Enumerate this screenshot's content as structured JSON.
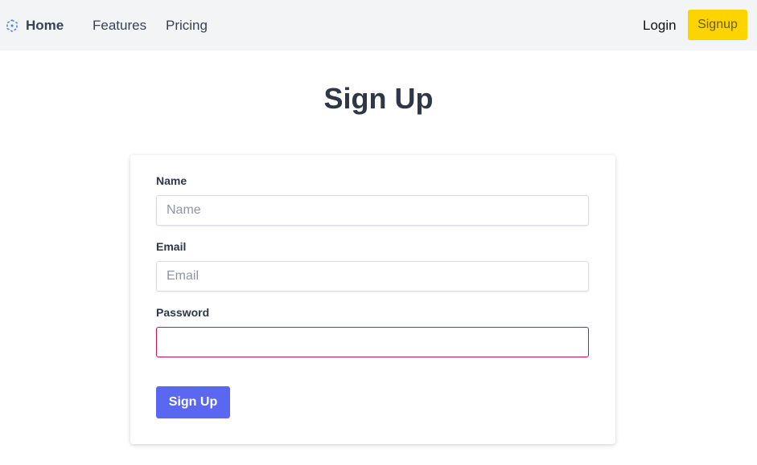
{
  "navbar": {
    "brand_label": "Home",
    "brand_icon": "cube-logo-icon",
    "links": [
      "Features",
      "Pricing"
    ],
    "login_label": "Login",
    "signup_label": "Signup"
  },
  "page": {
    "title": "Sign Up"
  },
  "form": {
    "name_label": "Name",
    "name_placeholder": "Name",
    "name_value": "",
    "email_label": "Email",
    "email_placeholder": "Email",
    "email_value": "",
    "password_label": "Password",
    "password_value": "",
    "submit_label": "Sign Up"
  },
  "colors": {
    "navbar_bg": "#f3f4f6",
    "signup_button": "#fcd400",
    "submit_button": "#5a67f0",
    "password_error_border": "#d0104c",
    "brand_icon": "#4a90e2"
  }
}
